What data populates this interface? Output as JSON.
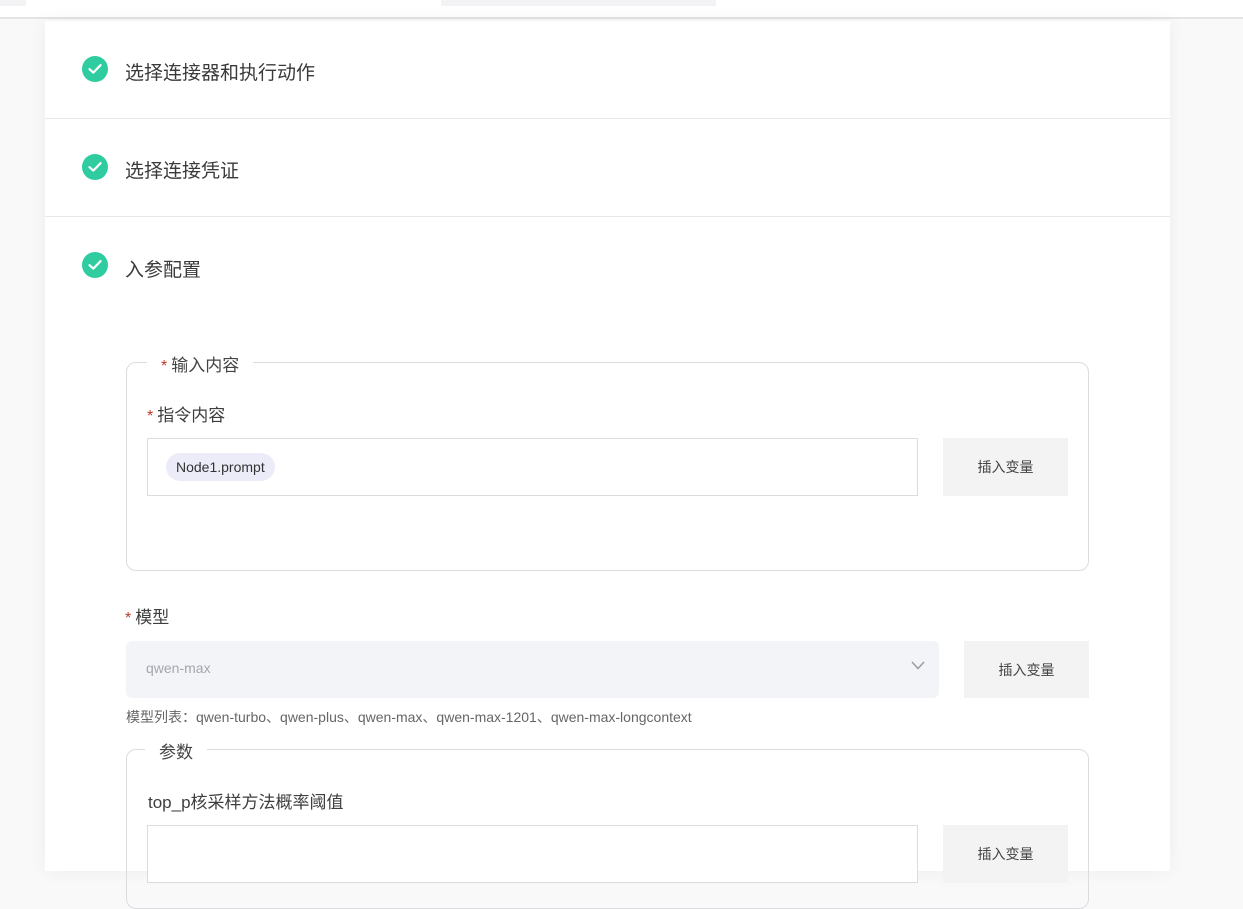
{
  "steps": [
    {
      "label": "选择连接器和执行动作"
    },
    {
      "label": "选择连接凭证"
    },
    {
      "label": "入参配置"
    }
  ],
  "input_section": {
    "legend": "输入内容",
    "instruction_label": "指令内容",
    "variable_tag": "Node1.prompt",
    "insert_button": "插入变量"
  },
  "model": {
    "label": "模型",
    "placeholder": "qwen-max",
    "insert_button": "插入变量",
    "hint": "模型列表：qwen-turbo、qwen-plus、qwen-max、qwen-max-1201、qwen-max-longcontext"
  },
  "params_section": {
    "legend": "参数",
    "top_p_label": "top_p核采样方法概率阈值",
    "insert_button": "插入变量"
  },
  "colors": {
    "success": "#2ecc9f",
    "required": "#c0392b"
  }
}
